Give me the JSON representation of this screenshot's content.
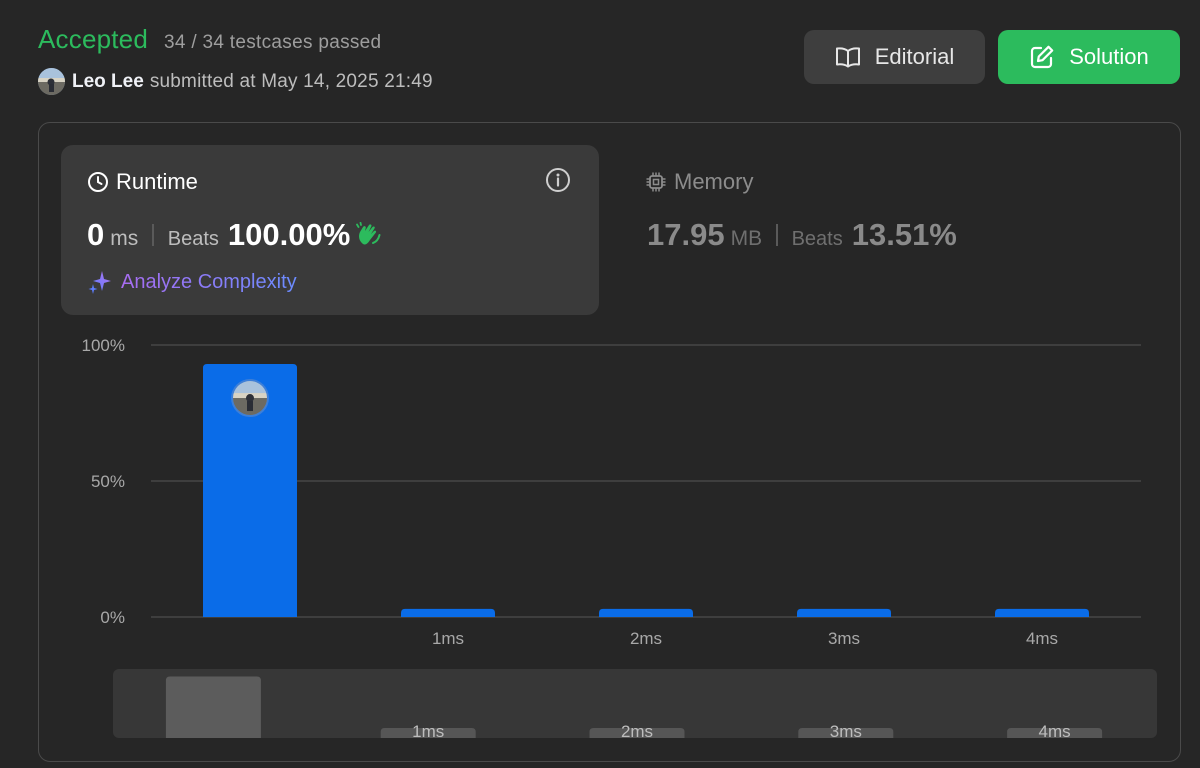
{
  "submission": {
    "status": "Accepted",
    "testcases": "34 / 34 testcases passed",
    "user_name": "Leo Lee",
    "submitted_text": "submitted at May 14, 2025 21:49"
  },
  "actions": {
    "editorial_label": "Editorial",
    "solution_label": "Solution"
  },
  "runtime": {
    "title": "Runtime",
    "value": "0",
    "unit": "ms",
    "beats_label": "Beats",
    "beats_value": "100.00%",
    "analyze_label": "Analyze Complexity"
  },
  "memory": {
    "title": "Memory",
    "value": "17.95",
    "unit": "MB",
    "beats_label": "Beats",
    "beats_value": "13.51%"
  },
  "icons": {
    "clap": "clapping-hands-icon",
    "info": "info-icon",
    "clock": "clock-icon",
    "chip": "chip-icon",
    "sparkle": "sparkle-icon",
    "book": "book-icon",
    "edit": "edit-icon"
  },
  "colors": {
    "accepted": "#2cbb5d",
    "bar": "#0a6ce8",
    "navigator_bar": "#5c5c5c",
    "navigator_bar_inactive": "#565656"
  },
  "chart_data": {
    "type": "bar",
    "yticks": [
      "100%",
      "50%",
      "0%"
    ],
    "ylim": [
      0,
      100
    ],
    "categories": [
      "",
      "1ms",
      "2ms",
      "3ms",
      "4ms"
    ],
    "values": [
      93,
      3,
      3,
      3,
      3
    ],
    "highlight_index": 0,
    "navigator": {
      "categories": [
        "",
        "1ms",
        "2ms",
        "3ms",
        "4ms"
      ],
      "values": [
        93,
        3,
        3,
        3,
        3
      ]
    }
  }
}
